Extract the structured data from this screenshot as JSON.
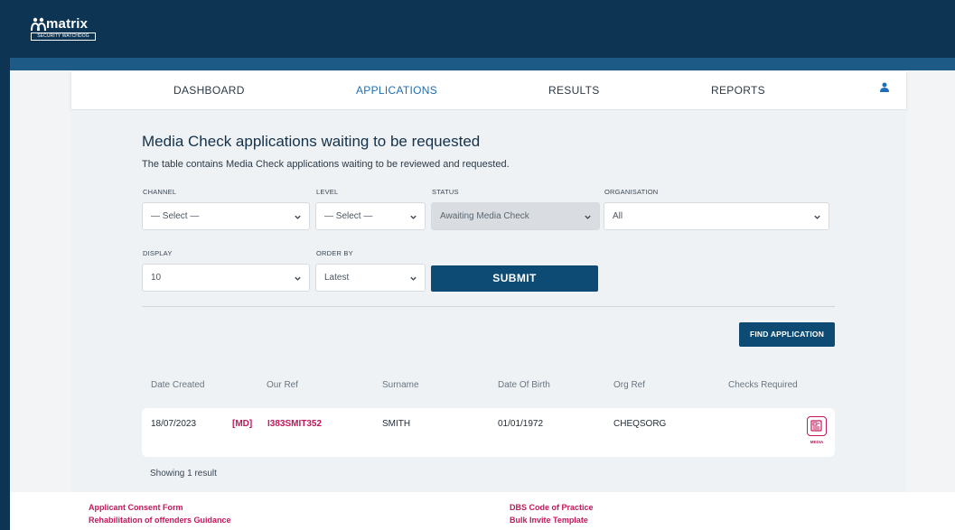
{
  "brand": {
    "name": "matrix",
    "tagline": "SECURITY WATCHDOG"
  },
  "nav": {
    "items": [
      {
        "label": "DASHBOARD",
        "active": false
      },
      {
        "label": "APPLICATIONS",
        "active": true
      },
      {
        "label": "RESULTS",
        "active": false
      },
      {
        "label": "REPORTS",
        "active": false
      }
    ],
    "user_icon": "user-icon"
  },
  "page": {
    "title": "Media Check applications waiting to be requested",
    "description": "The table contains Media Check applications waiting to be reviewed and requested."
  },
  "filters": {
    "channel": {
      "label": "CHANNEL",
      "value": "— Select —"
    },
    "level": {
      "label": "LEVEL",
      "value": "— Select —"
    },
    "status": {
      "label": "STATUS",
      "value": "Awaiting Media Check"
    },
    "organisation": {
      "label": "ORGANISATION",
      "value": "All"
    },
    "display": {
      "label": "DISPLAY",
      "value": "10"
    },
    "order_by": {
      "label": "ORDER BY",
      "value": "Latest"
    },
    "submit_label": "SUBMIT"
  },
  "find_application_label": "FIND APPLICATION",
  "table": {
    "headers": [
      "Date Created",
      "Our Ref",
      "Surname",
      "Date Of Birth",
      "Org Ref",
      "Checks Required"
    ],
    "rows": [
      {
        "date_created": "18/07/2023",
        "tag": "[MD]",
        "our_ref": "I383SMIT352",
        "surname": "SMITH",
        "date_of_birth": "01/01/1972",
        "org_ref": "CHEQSORG",
        "check_label": "MEDIA"
      }
    ],
    "showing": "Showing 1 result"
  },
  "footer": {
    "left_links": [
      "Applicant Consent Form",
      "Rehabilitation of offenders Guidance"
    ],
    "right_links": [
      "DBS Code of Practice",
      "Bulk Invite Template"
    ]
  },
  "colors": {
    "header_bg": "#0d3553",
    "accent_blue": "#1e6fb5",
    "button_bg": "#0e4b74",
    "link_red": "#c2185b"
  }
}
